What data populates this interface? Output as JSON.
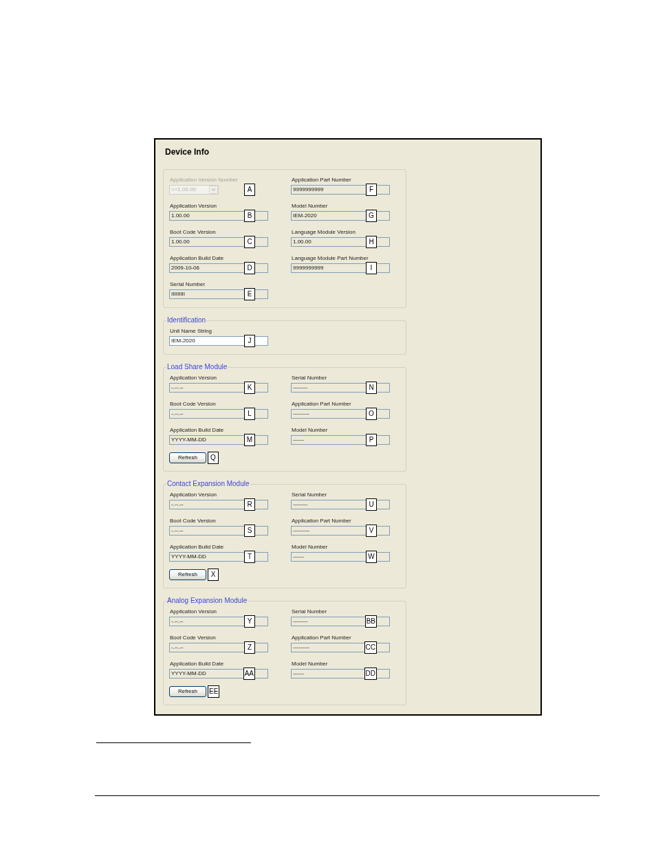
{
  "window": {
    "title": "Device Info"
  },
  "groups": [
    {
      "columns": [
        [
          {
            "label": "Application Version Number",
            "value": ">=1.00.00",
            "kind": "combo",
            "disabled": true,
            "callout": "A"
          },
          {
            "label": "Application Version",
            "value": "1.00.00",
            "kind": "readonly",
            "callout": "B"
          },
          {
            "label": "Boot Code Version",
            "value": "1.00.00",
            "kind": "readonly",
            "callout": "C"
          },
          {
            "label": "Application Build Date",
            "value": "2009-10-06",
            "kind": "readonly",
            "callout": "D"
          },
          {
            "label": "Serial Number",
            "value": "IIIIIIIII",
            "kind": "readonly",
            "callout": "E"
          }
        ],
        [
          {
            "label": "Application Part Number",
            "value": "9999999999",
            "kind": "readonly",
            "callout": "F"
          },
          {
            "label": "Model Number",
            "value": "IEM-2020",
            "kind": "readonly",
            "callout": "G"
          },
          {
            "label": "Language Module Version",
            "value": "1.00.00",
            "kind": "readonly",
            "callout": "H"
          },
          {
            "label": "Language Module Part Number",
            "value": "9999999999",
            "kind": "readonly",
            "callout": "I"
          }
        ]
      ]
    },
    {
      "legend": "Identification",
      "columns": [
        [
          {
            "label": "Unit Name String",
            "value": "IEM-2020",
            "kind": "input",
            "callout": "J"
          }
        ]
      ]
    },
    {
      "legend": "Load Share Module",
      "columns": [
        [
          {
            "label": "Application Version",
            "value": "-.--.--",
            "kind": "readonly",
            "callout": "K"
          },
          {
            "label": "Boot Code Version",
            "value": "-.--.--",
            "kind": "readonly",
            "callout": "L"
          },
          {
            "label": "Application Build Date",
            "value": "YYYY-MM-DD",
            "kind": "readonly",
            "callout": "M"
          }
        ],
        [
          {
            "label": "Serial Number",
            "value": "--------",
            "kind": "readonly",
            "callout": "N"
          },
          {
            "label": "Application Part Number",
            "value": "---------",
            "kind": "readonly",
            "callout": "O"
          },
          {
            "label": "Model Number",
            "value": "------",
            "kind": "readonly",
            "callout": "P"
          }
        ]
      ],
      "refresh": {
        "label": "Refresh",
        "callout": "Q"
      }
    },
    {
      "legend": "Contact Expansion Module",
      "columns": [
        [
          {
            "label": "Application Version",
            "value": "-.--.--",
            "kind": "readonly",
            "callout": "R"
          },
          {
            "label": "Boot Code Version",
            "value": "-.--.--",
            "kind": "readonly",
            "callout": "S"
          },
          {
            "label": "Application Build Date",
            "value": "YYYY-MM-DD",
            "kind": "readonly",
            "callout": "T"
          }
        ],
        [
          {
            "label": "Serial Number",
            "value": "--------",
            "kind": "readonly",
            "callout": "U"
          },
          {
            "label": "Application Part Number",
            "value": "---------",
            "kind": "readonly",
            "callout": "V"
          },
          {
            "label": "Model Number",
            "value": "------",
            "kind": "readonly",
            "callout": "W"
          }
        ]
      ],
      "refresh": {
        "label": "Refresh",
        "callout": "X"
      }
    },
    {
      "legend": "Analog Expansion Module",
      "columns": [
        [
          {
            "label": "Application Version",
            "value": "-.--.--",
            "kind": "readonly",
            "callout": "Y"
          },
          {
            "label": "Boot Code Version",
            "value": "-.--.--",
            "kind": "readonly",
            "callout": "Z"
          },
          {
            "label": "Application Build Date",
            "value": "YYYY-MM-DD",
            "kind": "readonly",
            "callout": "AA"
          }
        ],
        [
          {
            "label": "Serial Number",
            "value": "--------",
            "kind": "readonly",
            "callout": "BB"
          },
          {
            "label": "Application Part Number",
            "value": "---------",
            "kind": "readonly",
            "callout": "CC"
          },
          {
            "label": "Model Number",
            "value": "------",
            "kind": "readonly",
            "callout": "DD"
          }
        ]
      ],
      "refresh": {
        "label": "Refresh",
        "callout": "EE"
      }
    }
  ]
}
